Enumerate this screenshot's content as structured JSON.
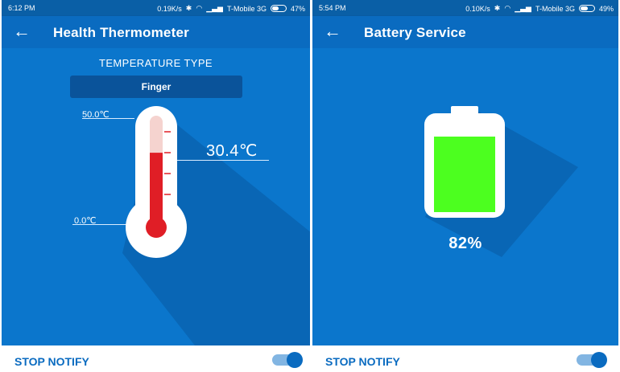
{
  "left_screen": {
    "status": {
      "time": "6:12 PM",
      "speed": "0.19K/s",
      "carrier": "T-Mobile 3G",
      "battery": "47%",
      "battery_level": 0.47
    },
    "app_bar": {
      "back_icon": "arrow-left-icon",
      "title": "Health Thermometer"
    },
    "temperature_type": {
      "label": "TEMPERATURE TYPE",
      "selected": "Finger"
    },
    "thermometer": {
      "max_label": "50.0℃",
      "min_label": "0.0℃",
      "reading": "30.4℃",
      "min": 0,
      "max": 50,
      "value": 30.4
    },
    "bottom": {
      "stop_notify": "STOP NOTIFY",
      "toggle_on": true
    }
  },
  "right_screen": {
    "status": {
      "time": "5:54 PM",
      "speed": "0.10K/s",
      "carrier": "T-Mobile 3G",
      "battery": "49%",
      "battery_level": 0.49
    },
    "app_bar": {
      "back_icon": "arrow-left-icon",
      "title": "Battery Service"
    },
    "battery": {
      "percent_text": "82%",
      "level": 0.82,
      "fill_color": "#4cff1f"
    },
    "bottom": {
      "stop_notify": "STOP NOTIFY",
      "toggle_on": true
    }
  },
  "colors": {
    "primary_dark": "#0a5fa6",
    "primary": "#0a6bc0",
    "background": "#0b76cc",
    "mercury": "#e01e26",
    "accent": "#0a6bc0"
  }
}
